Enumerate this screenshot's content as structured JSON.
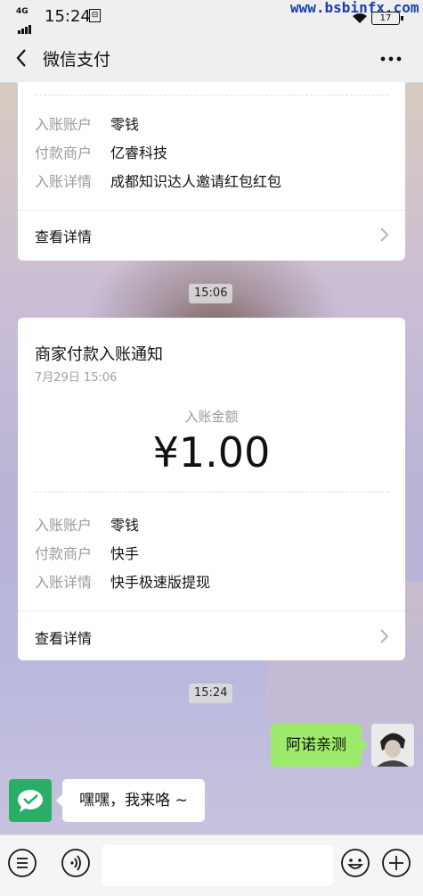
{
  "status_bar": {
    "network": "4G",
    "time": "15:24",
    "watermark": "www.bsbinfx.com",
    "battery": "17"
  },
  "nav": {
    "title": "微信支付"
  },
  "card_top": {
    "rows": [
      {
        "key": "入账账户",
        "value": "零钱"
      },
      {
        "key": "付款商户",
        "value": "亿睿科技"
      },
      {
        "key": "入账详情",
        "value": "成都知识达人邀请红包红包"
      }
    ],
    "detail_label": "查看详情"
  },
  "time_1": "15:06",
  "card_main": {
    "title": "商家付款入账通知",
    "date": "7月29日  15:06",
    "amount_label": "入账金额",
    "amount": "¥1.00",
    "rows": [
      {
        "key": "入账账户",
        "value": "零钱"
      },
      {
        "key": "付款商户",
        "value": "快手"
      },
      {
        "key": "入账详情",
        "value": "快手极速版提现"
      }
    ],
    "detail_label": "查看详情"
  },
  "time_2": "15:24",
  "chat": {
    "sent": "阿诺亲测",
    "received": "嘿嘿，我来咯 ~"
  },
  "colors": {
    "bubble_green": "#9eea6a",
    "wechat_green": "#2aae67"
  },
  "icons": {
    "back": "chevron-left-icon",
    "more": "more-icon",
    "menu": "menu-icon",
    "voice": "voice-icon",
    "emoji": "emoji-icon",
    "add": "add-icon"
  }
}
